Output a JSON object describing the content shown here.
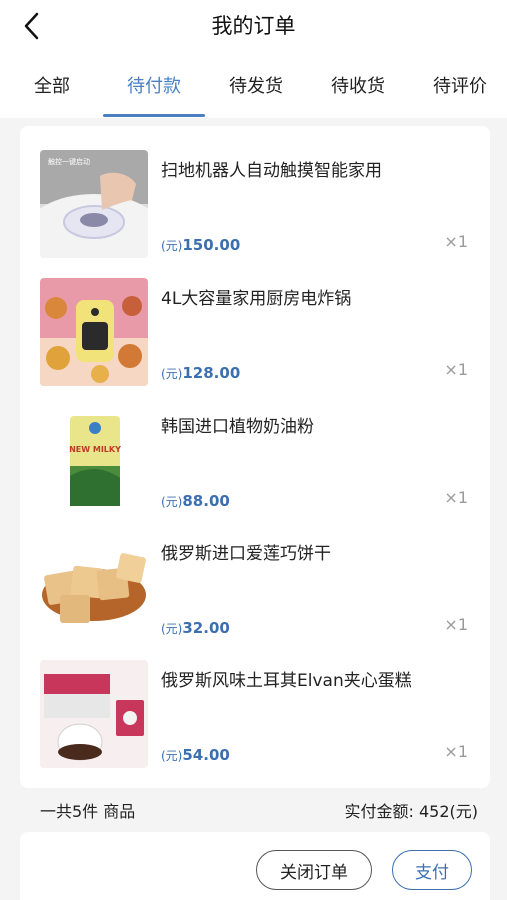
{
  "header": {
    "title": "我的订单"
  },
  "tabs": [
    {
      "label": "全部"
    },
    {
      "label": "待付款"
    },
    {
      "label": "待发货"
    },
    {
      "label": "待收货"
    },
    {
      "label": "待评价"
    }
  ],
  "active_tab": "待付款",
  "items": [
    {
      "name": "扫地机器人自动触摸智能家用",
      "price_unit": "(元)",
      "price": "150.00",
      "qty": "×1",
      "thumb_caption": "触控一键启动"
    },
    {
      "name": "4L大容量家用厨房电炸锅",
      "price_unit": "(元)",
      "price": "128.00",
      "qty": "×1"
    },
    {
      "name": "韩国进口植物奶油粉",
      "price_unit": "(元)",
      "price": "88.00",
      "qty": "×1",
      "thumb_caption": "NEW MILKY"
    },
    {
      "name": "俄罗斯进口爱莲巧饼干",
      "price_unit": "(元)",
      "price": "32.00",
      "qty": "×1"
    },
    {
      "name": "俄罗斯风味土耳其Elvan夹心蛋糕",
      "price_unit": "(元)",
      "price": "54.00",
      "qty": "×1"
    }
  ],
  "summary": {
    "count_text": "一共5件 商品",
    "total_text": "实付金额:  452(元)"
  },
  "actions": {
    "close_label": "关闭订单",
    "pay_label": "支付"
  },
  "colors": {
    "accent": "#4a7fc1",
    "price": "#3b6fb0",
    "background": "#f4f4f4"
  }
}
